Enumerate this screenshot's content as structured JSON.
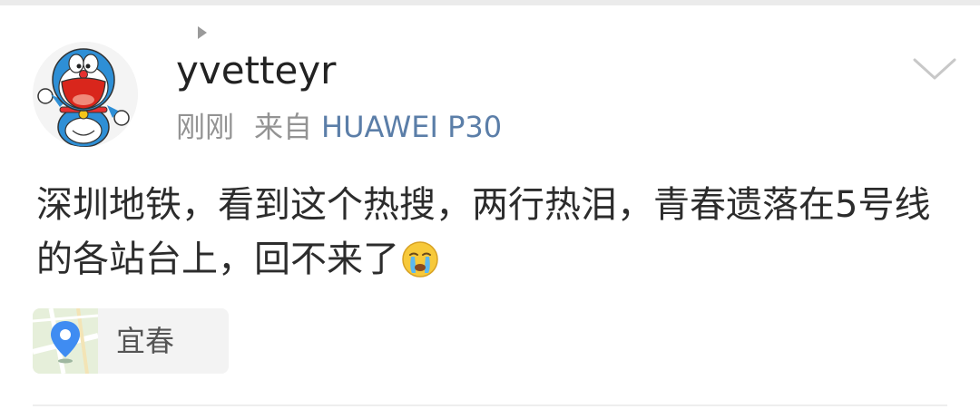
{
  "post": {
    "author": {
      "username": "yvetteyr",
      "avatar_icon": "doraemon-avatar-icon"
    },
    "meta": {
      "time": "刚刚",
      "source_prefix": "来自",
      "device": "HUAWEI P30"
    },
    "content_text": "深圳地铁，看到这个热搜，两行热泪，青春遗落在5号线的各站台上，回不来了",
    "content_emoji": "crying-face-emoji",
    "location": {
      "name": "宜春",
      "icon": "location-pin-icon"
    },
    "menu_icon": "chevron-down-icon"
  },
  "colors": {
    "username": "#222222",
    "meta": "#939393",
    "device_link": "#5b7ea8",
    "content": "#2c2c2c",
    "location_chip_bg": "#f3f3f3",
    "pin": "#3f8cf2"
  }
}
